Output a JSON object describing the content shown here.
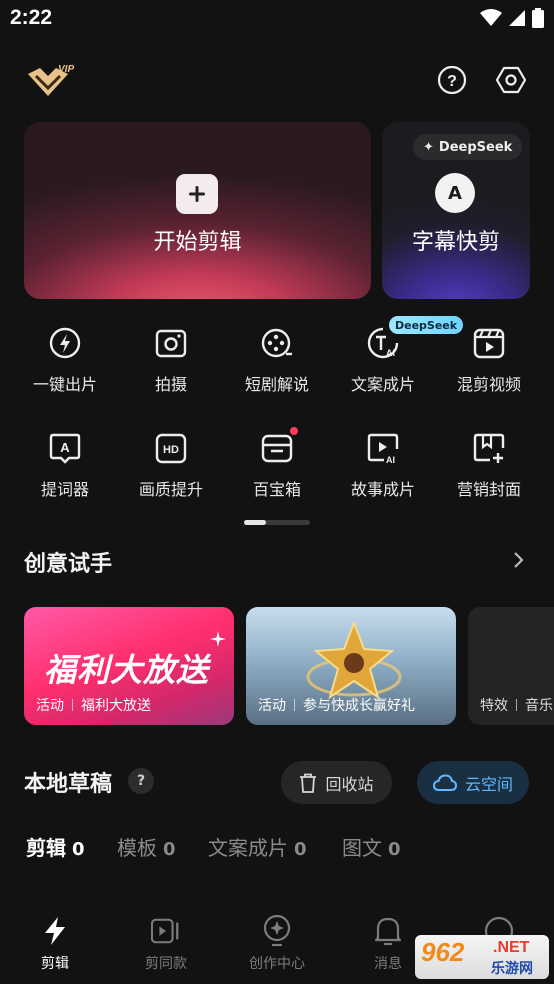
{
  "status_bar": {
    "time": "2:22"
  },
  "header": {
    "vip_label": "VIP"
  },
  "hero": {
    "start_edit_label": "开始剪辑",
    "subtitle_edit_label": "字幕快剪",
    "deepseek_pill": "DeepSeek",
    "avatar_letter": "A"
  },
  "tools": [
    {
      "label": "一键出片",
      "icon": "lightning-circle-icon"
    },
    {
      "label": "拍摄",
      "icon": "camera-icon"
    },
    {
      "label": "短剧解说",
      "icon": "film-reel-icon"
    },
    {
      "label": "文案成片",
      "icon": "text-ai-icon"
    },
    {
      "label": "混剪视频",
      "icon": "clapper-play-icon"
    },
    {
      "label": "提词器",
      "icon": "teleprompter-icon"
    },
    {
      "label": "画质提升",
      "icon": "hd-icon"
    },
    {
      "label": "百宝箱",
      "icon": "toolbox-icon"
    },
    {
      "label": "故事成片",
      "icon": "story-ai-icon"
    },
    {
      "label": "营销封面",
      "icon": "bookmark-cover-icon"
    }
  ],
  "tools_badge": "DeepSeek",
  "creative": {
    "title": "创意试手",
    "cards": [
      {
        "big_text": "福利大放送",
        "tag": "活动",
        "caption": "福利大放送"
      },
      {
        "tag": "活动",
        "caption": "参与快成长赢好礼"
      },
      {
        "tag": "特效",
        "caption": "音乐"
      }
    ]
  },
  "drafts": {
    "title": "本地草稿",
    "help": "?",
    "trash_label": "回收站",
    "cloud_label": "云空间",
    "tabs": [
      {
        "label": "剪辑",
        "count": "0"
      },
      {
        "label": "模板",
        "count": "0"
      },
      {
        "label": "文案成片",
        "count": "0"
      },
      {
        "label": "图文",
        "count": "0"
      }
    ]
  },
  "bottom_nav": [
    {
      "label": "剪辑",
      "icon": "lightning-icon"
    },
    {
      "label": "剪同款",
      "icon": "video-template-icon"
    },
    {
      "label": "创作中心",
      "icon": "bulb-icon"
    },
    {
      "label": "消息",
      "icon": "bell-icon"
    },
    {
      "label": "",
      "icon": "profile-icon"
    }
  ],
  "watermark": {
    "number": "962",
    "suffix": ".NET",
    "site": "乐游网"
  },
  "colors": {
    "background": "#121212",
    "accent_blue": "#5fb8ff",
    "hero_pink": "#ee5a70",
    "hero_purple": "#5a3fd0"
  }
}
